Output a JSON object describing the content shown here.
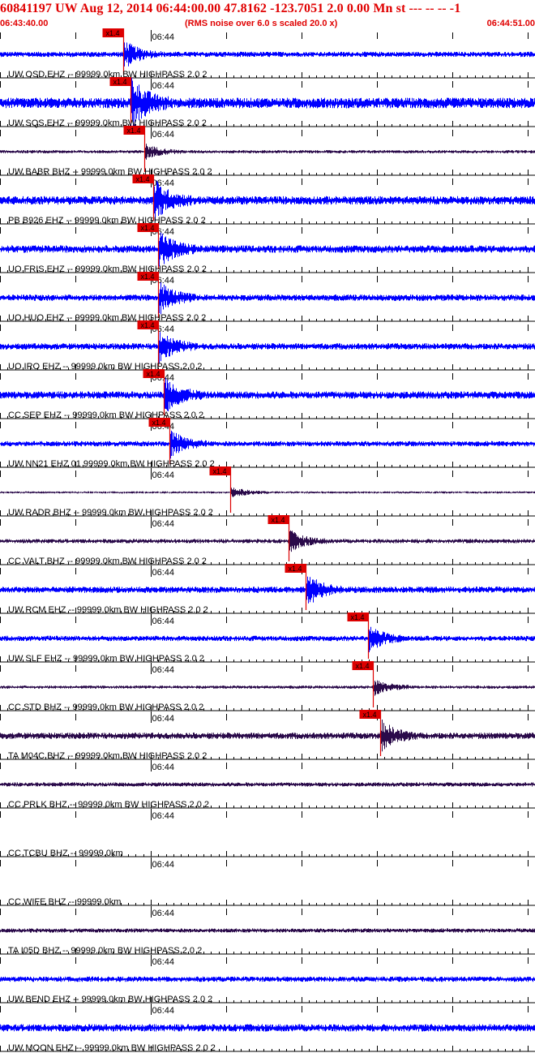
{
  "header": {
    "title": "60841197 UW Aug 12, 2014 06:44:00.00   47.8162 -123.7051  2.0 0.00 Mn st --- -- --   -1",
    "start_time": "06:43:40.00",
    "rms_note": "(RMS noise over 6.0 s scaled 20.0 x)",
    "end_time": "06:44:51.00"
  },
  "colors": {
    "title": "#e00000",
    "trace_blue": "#0000ff",
    "trace_purple": "#2a0a4a",
    "axis": "#000000",
    "pick": "#dd0000"
  },
  "minute_mark": "06:44",
  "pick_label": "x1.4",
  "traces": [
    {
      "label": "UW OSD EHZ -- 99999.0km BW  HIGHPASS  2.0  2",
      "color": "blue",
      "amp": 2.5,
      "pick_time": 16.4
    },
    {
      "label": "UW SQS EHZ -- 99999.0km BW  HIGHPASS  2.0  2",
      "color": "blue",
      "amp": 5.0,
      "pick_time": 17.3
    },
    {
      "label": "UW BABR BHZ -- 99999.0km BW  HIGHPASS  2.0  2",
      "color": "purple",
      "amp": 1.5,
      "pick_time": 19.1
    },
    {
      "label": "PB B926 EHZ -- 99999.0km BW  HIGHPASS  2.0  2",
      "color": "blue",
      "amp": 4.0,
      "pick_time": 20.3
    },
    {
      "label": "UO FRIS EHZ -- 99999.0km BW  HIGHPASS  2.0  2",
      "color": "blue",
      "amp": 3.5,
      "pick_time": 21.0
    },
    {
      "label": "UO HUO EHZ -- 99999.0km BW  HIGHPASS  2.0  2",
      "color": "blue",
      "amp": 3.0,
      "pick_time": 21.0
    },
    {
      "label": "UO IRO EHZ -- 99999.0km BW  HIGHPASS  2.0  2",
      "color": "blue",
      "amp": 3.0,
      "pick_time": 21.0
    },
    {
      "label": "CC SEP EHZ -- 99999.0km BW  HIGHPASS  2.0  2",
      "color": "blue",
      "amp": 3.5,
      "pick_time": 21.7
    },
    {
      "label": "UW NN21 EHZ 01 99999.0km BW  HIGHPASS  2.0  2",
      "color": "blue",
      "amp": 2.5,
      "pick_time": 22.5
    },
    {
      "label": "UW RADR BHZ -- 99999.0km BW  HIGHPASS  2.0  2",
      "color": "purple",
      "amp": 1.0,
      "pick_time": 30.6
    },
    {
      "label": "CC VALT BHZ -- 99999.0km BW  HIGHPASS  2.0  2",
      "color": "purple",
      "amp": 2.0,
      "pick_time": 38.3
    },
    {
      "label": "UW RCM EHZ -- 99999.0km BW  HIGHPASS  2.0  2",
      "color": "blue",
      "amp": 3.0,
      "pick_time": 40.6
    },
    {
      "label": "UW SLF EHZ -- 99999.0km BW  HIGHPASS  2.0  2",
      "color": "blue",
      "amp": 2.5,
      "pick_time": 48.8
    },
    {
      "label": "CC STD BHZ -- 99999.0km BW  HIGHPASS  2.0  2",
      "color": "purple",
      "amp": 1.5,
      "pick_time": 49.5
    },
    {
      "label": "TA M04C BHZ -- 99999.0km BW  HIGHPASS  2.0  2",
      "color": "purple",
      "amp": 3.0,
      "pick_time": 50.4
    },
    {
      "label": "CC PRLK BHZ -- 99999.0km BW  HIGHPASS  2.0  2",
      "color": "purple",
      "amp": 2.0,
      "pick_time": null
    },
    {
      "label": "CC TCBU BHZ -- 99999.0km",
      "color": "none",
      "amp": 0,
      "pick_time": null
    },
    {
      "label": "CC WIFE BHZ -- 99999.0km",
      "color": "none",
      "amp": 0,
      "pick_time": null
    },
    {
      "label": "TA I05D BHZ -- 99999.0km BW  HIGHPASS  2.0  2",
      "color": "purple",
      "amp": 2.0,
      "pick_time": null
    },
    {
      "label": "UW BEND EHZ -- 99999.0km BW  HIGHPASS  2.0  2",
      "color": "blue",
      "amp": 2.5,
      "pick_time": null
    },
    {
      "label": "UW MOON EHZ -- 99999.0km BW  HIGHPASS  2.0  2",
      "color": "blue",
      "amp": 3.5,
      "pick_time": null
    }
  ]
}
